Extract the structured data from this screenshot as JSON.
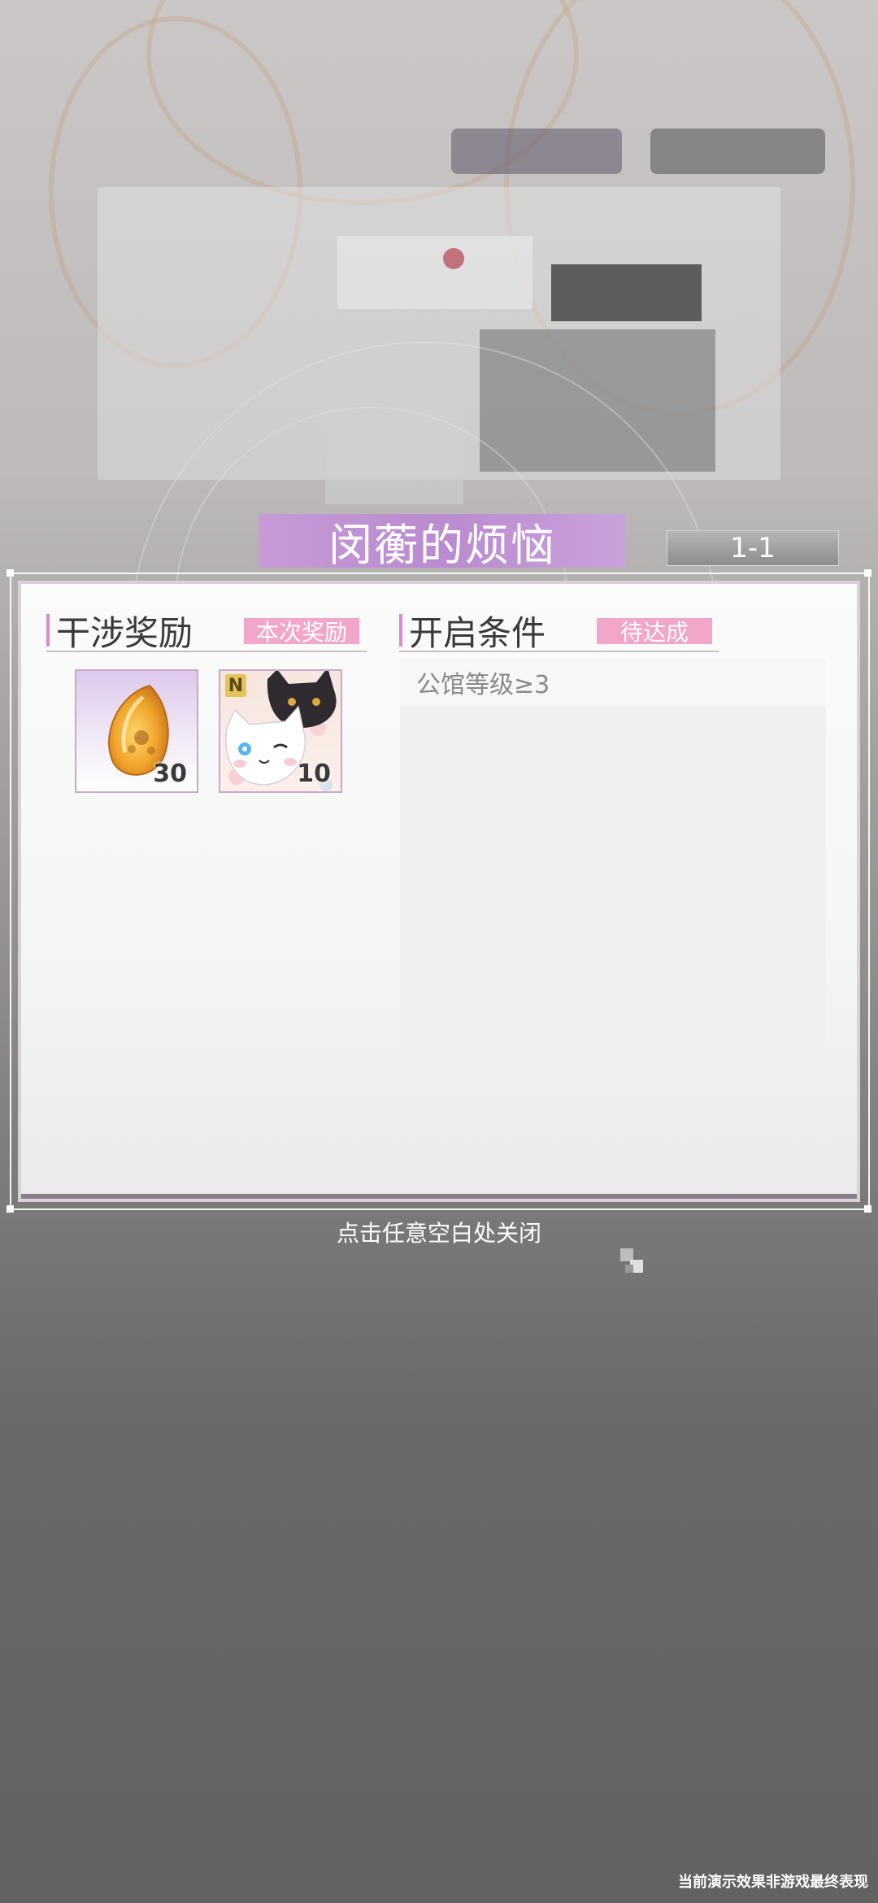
{
  "dialog": {
    "title": "闵蘅的烦恼",
    "stage": "1-1"
  },
  "rewards_section": {
    "title": "干涉奖励",
    "tag": "本次奖励",
    "items": [
      {
        "icon": "amber-gem-icon",
        "count": "30"
      },
      {
        "icon": "cat-card-icon",
        "badge": "N",
        "count": "10"
      }
    ]
  },
  "conditions_section": {
    "title": "开启条件",
    "tag": "待达成",
    "items": [
      "公馆等级≥3"
    ]
  },
  "close_hint": "点击任意空白处关闭",
  "footer_note": "当前演示效果非游戏最终表现",
  "colors": {
    "title_banner": "#c69bd6",
    "tag_pink": "#f2a6c9",
    "accent_bar": "#d78bd5"
  }
}
